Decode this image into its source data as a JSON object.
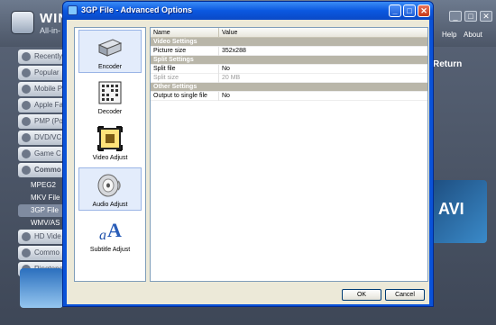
{
  "background_app": {
    "title": "WIN",
    "subtitle": "All-in-",
    "menu": [
      "Help",
      "About"
    ],
    "sidebar_items": [
      "Recently",
      "Popular",
      "Mobile P",
      "Apple Fa",
      "PMP (Po",
      "DVD/VC",
      "Game C",
      "Commo"
    ],
    "sidebar_subitems": [
      "MPEG2",
      "MKV File",
      "3GP File",
      "WMV/AS"
    ],
    "sidebar_items_2": [
      "HD Vide",
      "Commo",
      "Ringtone"
    ],
    "return_label": "Return",
    "panel_text": "AVI"
  },
  "dialog": {
    "title": "3GP File - Advanced Options",
    "minimize": "_",
    "maximize": "□",
    "close": "✕",
    "categories": [
      {
        "label": "Encoder",
        "icon": "encoder-icon",
        "selected": true
      },
      {
        "label": "Decoder",
        "icon": "decoder-icon",
        "selected": false
      },
      {
        "label": "Video Adjust",
        "icon": "video-adjust-icon",
        "selected": false
      },
      {
        "label": "Audio Adjust",
        "icon": "audio-adjust-icon",
        "selected": true
      },
      {
        "label": "Subtitle Adjust",
        "icon": "subtitle-adjust-icon",
        "selected": false
      }
    ],
    "grid": {
      "col_name": "Name",
      "col_value": "Value",
      "rows": [
        {
          "type": "section",
          "name": "Video Settings"
        },
        {
          "type": "prop",
          "name": "Picture size",
          "value": "352x288"
        },
        {
          "type": "section",
          "name": "Split Settings"
        },
        {
          "type": "prop",
          "name": "Split file",
          "value": "No"
        },
        {
          "type": "prop",
          "name": "Split size",
          "value": "20 MB",
          "disabled": true
        },
        {
          "type": "section",
          "name": "Other Settings"
        },
        {
          "type": "prop",
          "name": "Output to single file",
          "value": "No"
        }
      ]
    },
    "ok_label": "OK",
    "cancel_label": "Cancel"
  },
  "colors": {
    "titlebar": "#0b58e0",
    "section_bg": "#b9b6a9",
    "client_bg": "#ece9d8"
  }
}
